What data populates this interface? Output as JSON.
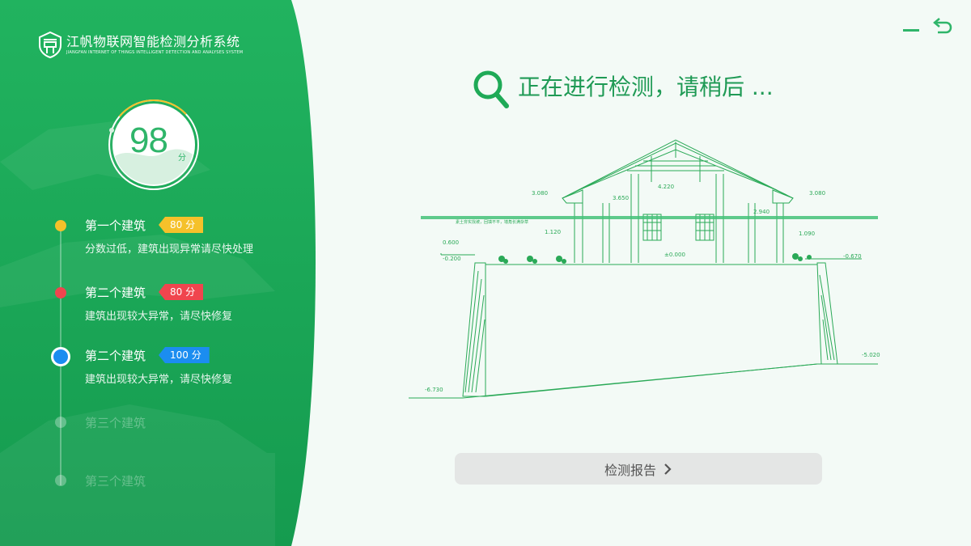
{
  "app": {
    "title": "江帆物联网智能检测分析系统",
    "subtitle": "JIANGFAN INTERNET OF THINGS INTELLIGENT DETECTION AND ANALYSES SYSTEM"
  },
  "score": {
    "value": "98",
    "unit": "分",
    "fraction": 0.98
  },
  "steps": [
    {
      "title": "第一个建筑",
      "badge": "80 分",
      "desc": "分数过低，建筑出现异常请尽快处理",
      "color": "#f5c12a",
      "state": "done"
    },
    {
      "title": "第二个建筑",
      "badge": "80 分",
      "desc": "建筑出现较大异常，请尽快修复",
      "color": "#f0454e",
      "state": "done"
    },
    {
      "title": "第二个建筑",
      "badge": "100 分",
      "desc": "建筑出现较大异常，请尽快修复",
      "color": "#1b8df0",
      "state": "current"
    },
    {
      "title": "第三个建筑",
      "state": "pending"
    },
    {
      "title": "第三个建筑",
      "state": "pending"
    }
  ],
  "status": {
    "text": "正在进行检测，请稍后 ..."
  },
  "drawing": {
    "labels": {
      "l1": "3.080",
      "l2": "3.650",
      "l3": "4.220",
      "l4": "3.080",
      "l5": "2.940",
      "l6": "1.120",
      "l7": "1.090",
      "l8": "0.600",
      "l9": "-0.200",
      "l10": "±0.000",
      "l11": "-0.670",
      "l12": "-5.020",
      "l13": "-6.730",
      "note": "素土夯实找坡，回填不平，墙角长满杂草"
    }
  },
  "report_button": {
    "label": "检测报告"
  },
  "colors": {
    "primary": "#1faa57",
    "accent_text": "#1f9a55"
  }
}
